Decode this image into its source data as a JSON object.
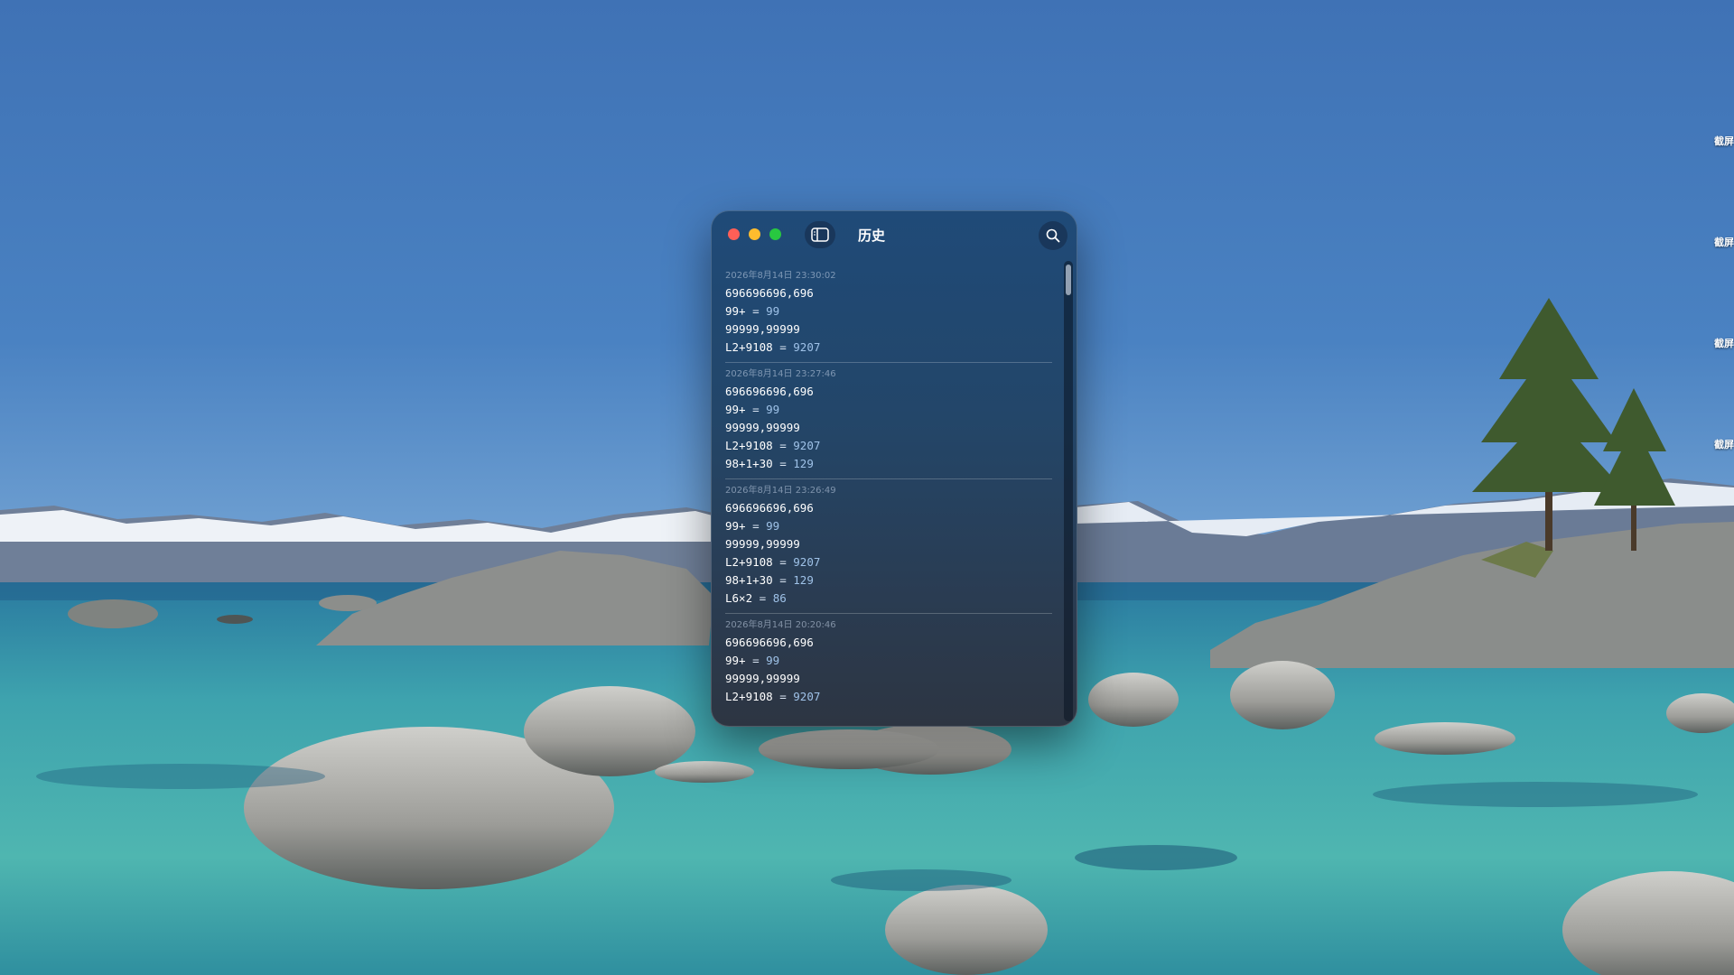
{
  "window": {
    "title": "历史"
  },
  "desktop": {
    "side_labels": [
      "截屏",
      "截屏",
      "截屏",
      "截屏"
    ]
  },
  "history": [
    {
      "date": "2026年8月14日 23:30:02",
      "lines": [
        {
          "expr": "696696696,696",
          "result": ""
        },
        {
          "expr": "99+",
          "result": "99"
        },
        {
          "expr": "99999,99999",
          "result": ""
        },
        {
          "expr": "L2+9108",
          "result": "9207"
        }
      ]
    },
    {
      "date": "2026年8月14日 23:27:46",
      "lines": [
        {
          "expr": "696696696,696",
          "result": ""
        },
        {
          "expr": "99+",
          "result": "99"
        },
        {
          "expr": "99999,99999",
          "result": ""
        },
        {
          "expr": "L2+9108",
          "result": "9207"
        },
        {
          "expr": "98+1+30",
          "result": "129"
        }
      ]
    },
    {
      "date": "2026年8月14日 23:26:49",
      "lines": [
        {
          "expr": "696696696,696",
          "result": ""
        },
        {
          "expr": "99+",
          "result": "99"
        },
        {
          "expr": "99999,99999",
          "result": ""
        },
        {
          "expr": "L2+9108",
          "result": "9207"
        },
        {
          "expr": "98+1+30",
          "result": "129"
        },
        {
          "expr": "L6×2",
          "result": "86"
        }
      ]
    },
    {
      "date": "2026年8月14日 20:20:46",
      "lines": [
        {
          "expr": "696696696,696",
          "result": ""
        },
        {
          "expr": "99+",
          "result": "99"
        },
        {
          "expr": "99999,99999",
          "result": ""
        },
        {
          "expr": "L2+9108",
          "result": "9207"
        }
      ]
    }
  ],
  "icons": {
    "sidebar": "sidebar-toggle-icon",
    "search": "search-icon"
  }
}
